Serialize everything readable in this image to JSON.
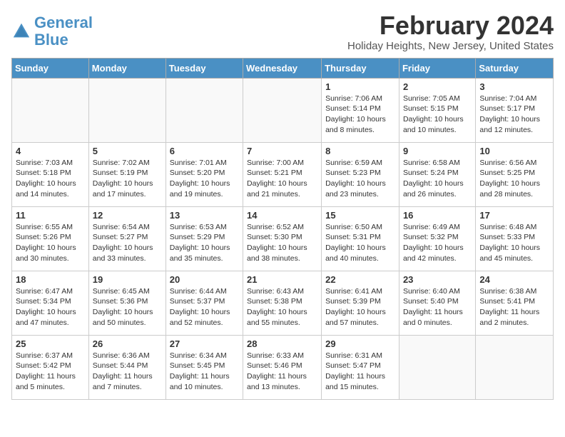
{
  "logo": {
    "name_part1": "General",
    "name_part2": "Blue"
  },
  "header": {
    "month_title": "February 2024",
    "location": "Holiday Heights, New Jersey, United States"
  },
  "days_of_week": [
    "Sunday",
    "Monday",
    "Tuesday",
    "Wednesday",
    "Thursday",
    "Friday",
    "Saturday"
  ],
  "weeks": [
    [
      {
        "day": "",
        "detail": ""
      },
      {
        "day": "",
        "detail": ""
      },
      {
        "day": "",
        "detail": ""
      },
      {
        "day": "",
        "detail": ""
      },
      {
        "day": "1",
        "detail": "Sunrise: 7:06 AM\nSunset: 5:14 PM\nDaylight: 10 hours and 8 minutes."
      },
      {
        "day": "2",
        "detail": "Sunrise: 7:05 AM\nSunset: 5:15 PM\nDaylight: 10 hours and 10 minutes."
      },
      {
        "day": "3",
        "detail": "Sunrise: 7:04 AM\nSunset: 5:17 PM\nDaylight: 10 hours and 12 minutes."
      }
    ],
    [
      {
        "day": "4",
        "detail": "Sunrise: 7:03 AM\nSunset: 5:18 PM\nDaylight: 10 hours and 14 minutes."
      },
      {
        "day": "5",
        "detail": "Sunrise: 7:02 AM\nSunset: 5:19 PM\nDaylight: 10 hours and 17 minutes."
      },
      {
        "day": "6",
        "detail": "Sunrise: 7:01 AM\nSunset: 5:20 PM\nDaylight: 10 hours and 19 minutes."
      },
      {
        "day": "7",
        "detail": "Sunrise: 7:00 AM\nSunset: 5:21 PM\nDaylight: 10 hours and 21 minutes."
      },
      {
        "day": "8",
        "detail": "Sunrise: 6:59 AM\nSunset: 5:23 PM\nDaylight: 10 hours and 23 minutes."
      },
      {
        "day": "9",
        "detail": "Sunrise: 6:58 AM\nSunset: 5:24 PM\nDaylight: 10 hours and 26 minutes."
      },
      {
        "day": "10",
        "detail": "Sunrise: 6:56 AM\nSunset: 5:25 PM\nDaylight: 10 hours and 28 minutes."
      }
    ],
    [
      {
        "day": "11",
        "detail": "Sunrise: 6:55 AM\nSunset: 5:26 PM\nDaylight: 10 hours and 30 minutes."
      },
      {
        "day": "12",
        "detail": "Sunrise: 6:54 AM\nSunset: 5:27 PM\nDaylight: 10 hours and 33 minutes."
      },
      {
        "day": "13",
        "detail": "Sunrise: 6:53 AM\nSunset: 5:29 PM\nDaylight: 10 hours and 35 minutes."
      },
      {
        "day": "14",
        "detail": "Sunrise: 6:52 AM\nSunset: 5:30 PM\nDaylight: 10 hours and 38 minutes."
      },
      {
        "day": "15",
        "detail": "Sunrise: 6:50 AM\nSunset: 5:31 PM\nDaylight: 10 hours and 40 minutes."
      },
      {
        "day": "16",
        "detail": "Sunrise: 6:49 AM\nSunset: 5:32 PM\nDaylight: 10 hours and 42 minutes."
      },
      {
        "day": "17",
        "detail": "Sunrise: 6:48 AM\nSunset: 5:33 PM\nDaylight: 10 hours and 45 minutes."
      }
    ],
    [
      {
        "day": "18",
        "detail": "Sunrise: 6:47 AM\nSunset: 5:34 PM\nDaylight: 10 hours and 47 minutes."
      },
      {
        "day": "19",
        "detail": "Sunrise: 6:45 AM\nSunset: 5:36 PM\nDaylight: 10 hours and 50 minutes."
      },
      {
        "day": "20",
        "detail": "Sunrise: 6:44 AM\nSunset: 5:37 PM\nDaylight: 10 hours and 52 minutes."
      },
      {
        "day": "21",
        "detail": "Sunrise: 6:43 AM\nSunset: 5:38 PM\nDaylight: 10 hours and 55 minutes."
      },
      {
        "day": "22",
        "detail": "Sunrise: 6:41 AM\nSunset: 5:39 PM\nDaylight: 10 hours and 57 minutes."
      },
      {
        "day": "23",
        "detail": "Sunrise: 6:40 AM\nSunset: 5:40 PM\nDaylight: 11 hours and 0 minutes."
      },
      {
        "day": "24",
        "detail": "Sunrise: 6:38 AM\nSunset: 5:41 PM\nDaylight: 11 hours and 2 minutes."
      }
    ],
    [
      {
        "day": "25",
        "detail": "Sunrise: 6:37 AM\nSunset: 5:42 PM\nDaylight: 11 hours and 5 minutes."
      },
      {
        "day": "26",
        "detail": "Sunrise: 6:36 AM\nSunset: 5:44 PM\nDaylight: 11 hours and 7 minutes."
      },
      {
        "day": "27",
        "detail": "Sunrise: 6:34 AM\nSunset: 5:45 PM\nDaylight: 11 hours and 10 minutes."
      },
      {
        "day": "28",
        "detail": "Sunrise: 6:33 AM\nSunset: 5:46 PM\nDaylight: 11 hours and 13 minutes."
      },
      {
        "day": "29",
        "detail": "Sunrise: 6:31 AM\nSunset: 5:47 PM\nDaylight: 11 hours and 15 minutes."
      },
      {
        "day": "",
        "detail": ""
      },
      {
        "day": "",
        "detail": ""
      }
    ]
  ]
}
